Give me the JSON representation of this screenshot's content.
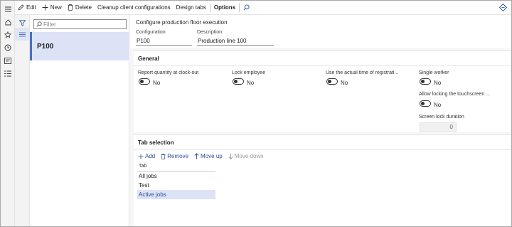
{
  "colors": {
    "accent": "#4a6ec2",
    "selection": "#dce3f7",
    "link": "#2b4f9b"
  },
  "nav_icons": [
    "hamburger-icon",
    "home-icon",
    "star-icon",
    "clock-icon",
    "workspace-icon",
    "list-icon"
  ],
  "actionbar": {
    "edit": "Edit",
    "new": "New",
    "delete": "Delete",
    "cleanup": "Cleanup client configurations",
    "design_tabs": "Design tabs",
    "options": "Options"
  },
  "list": {
    "filter_placeholder": "Filter",
    "items": [
      {
        "label": "P100"
      }
    ]
  },
  "details": {
    "title": "Configure production floor execution",
    "configuration_label": "Configuration",
    "configuration_value": "P100",
    "description_label": "Description",
    "description_value": "Production line 100"
  },
  "general": {
    "title": "General",
    "report_quantity_label": "Report quantity at clock-out",
    "report_quantity_value": "No",
    "lock_employee_label": "Lock employee",
    "lock_employee_value": "No",
    "actual_time_label": "Use the actual time of registrati...",
    "actual_time_value": "No",
    "single_worker_label": "Single worker",
    "single_worker_value": "No",
    "allow_locking_label": "Allow locking the touchscreen ...",
    "allow_locking_value": "No",
    "screen_lock_label": "Screen lock duration",
    "screen_lock_value": "0"
  },
  "tab_selection": {
    "title": "Tab selection",
    "add": "Add",
    "remove": "Remove",
    "move_up": "Move up",
    "move_down": "Move down",
    "column_header": "Tab",
    "rows": [
      "All jobs",
      "Test",
      "Active jobs"
    ]
  }
}
